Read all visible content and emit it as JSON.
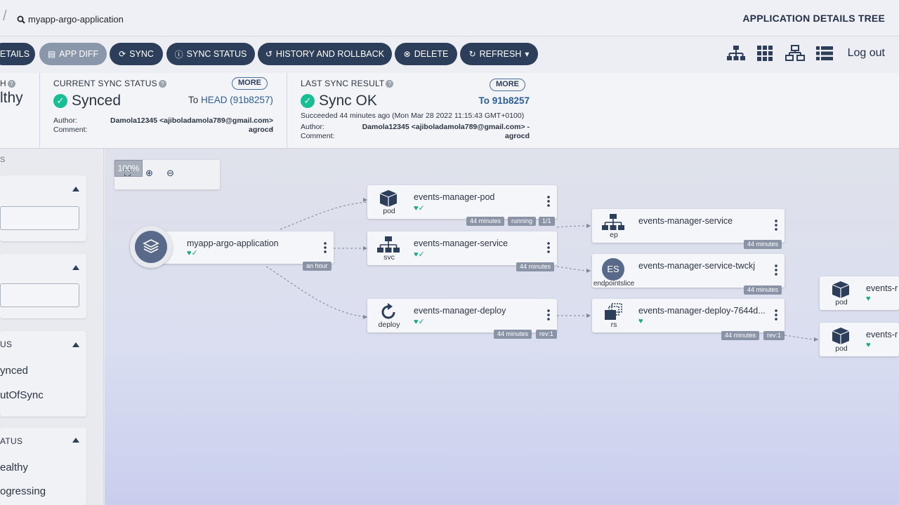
{
  "topbar": {
    "search": "myapp-argo-application",
    "title": "APPLICATION DETAILS TREE"
  },
  "toolbar": {
    "details": "ETAILS",
    "app_diff": "APP DIFF",
    "sync": "SYNC",
    "sync_status": "SYNC STATUS",
    "history": "HISTORY AND ROLLBACK",
    "delete": "DELETE",
    "refresh": "REFRESH",
    "logout": "Log out"
  },
  "health": {
    "label_partial": "H",
    "value_partial": "lthy"
  },
  "current_sync": {
    "label": "CURRENT SYNC STATUS",
    "value": "Synced",
    "more": "MORE",
    "to_prefix": "To",
    "to_ref": "HEAD (91b8257)",
    "author_label": "Author:",
    "comment_label": "Comment:",
    "author": "Damola12345 <ajiboladamola789@gmail.com> -",
    "comment": "agrocd"
  },
  "last_sync": {
    "label": "LAST SYNC RESULT",
    "value": "Sync OK",
    "more": "MORE",
    "to": "To 91b8257",
    "succeeded": "Succeeded 44 minutes ago (Mon Mar 28 2022 11:15:43 GMT+0100)",
    "author_label": "Author:",
    "comment_label": "Comment:",
    "author": "Damola12345 <ajiboladamola789@gmail.com> -",
    "comment": "agrocd"
  },
  "sidebar": {
    "top_letter": "S",
    "sync_head": "US",
    "synced": "ynced",
    "outofsync": "utOfSync",
    "health_head": "ATUS",
    "healthy": "ealthy",
    "progressing": "ogressing"
  },
  "zoom": {
    "level": "100%"
  },
  "nodes": {
    "app": {
      "name": "myapp-argo-application",
      "tags": [
        "an hour"
      ]
    },
    "pod": {
      "name": "events-manager-pod",
      "kind": "pod",
      "tags": [
        "44 minutes",
        "running",
        "1/1"
      ]
    },
    "svc": {
      "name": "events-manager-service",
      "kind": "svc",
      "tags": [
        "44 minutes"
      ]
    },
    "deploy": {
      "name": "events-manager-deploy",
      "kind": "deploy",
      "tags": [
        "44 minutes",
        "rev:1"
      ]
    },
    "ep": {
      "name": "events-manager-service",
      "kind": "ep",
      "tags": [
        "44 minutes"
      ]
    },
    "es": {
      "name": "events-manager-service-twckj",
      "kind": "endpointslice",
      "badge": "ES",
      "tags": [
        "44 minutes"
      ]
    },
    "rs": {
      "name": "events-manager-deploy-7644d...",
      "kind": "rs",
      "tags": [
        "44 minutes",
        "rev:1"
      ]
    },
    "pod2": {
      "name": "events-r",
      "kind": "pod"
    },
    "pod3": {
      "name": "events-r",
      "kind": "pod"
    }
  }
}
